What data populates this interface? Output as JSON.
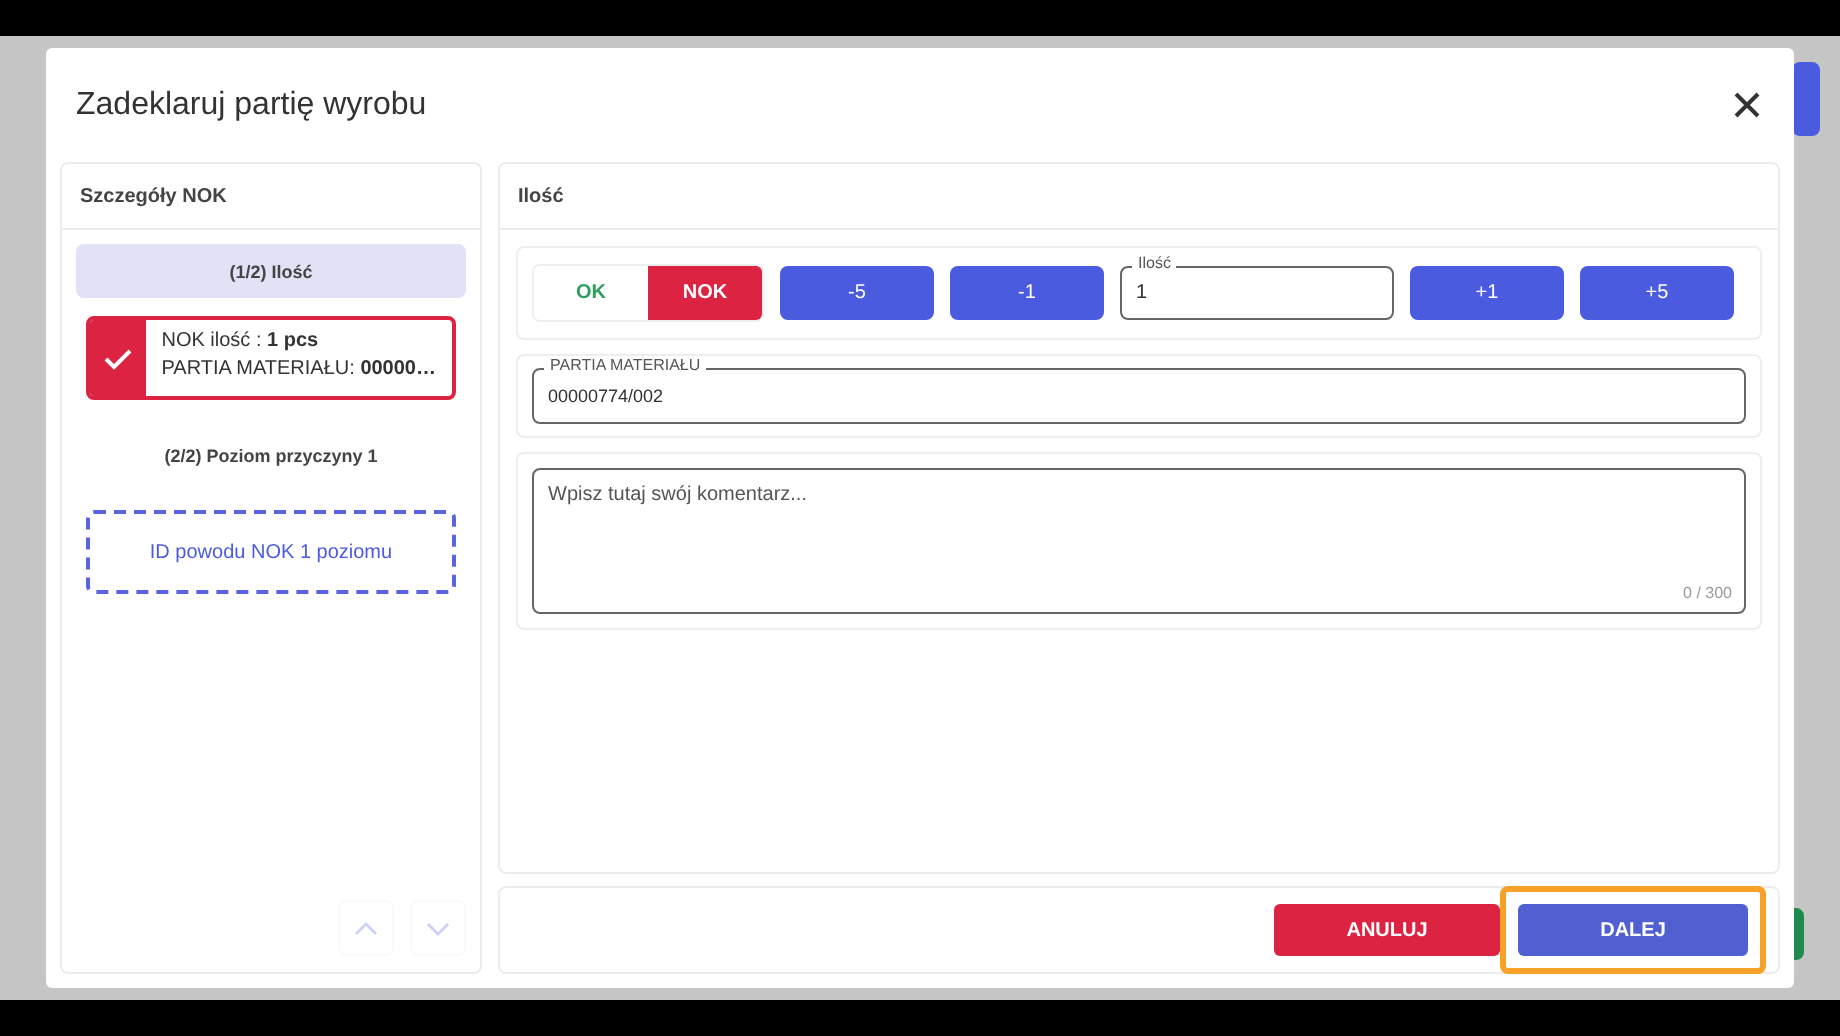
{
  "dialog": {
    "title": "Zadeklaruj partię wyrobu"
  },
  "details_panel": {
    "title": "Szczegóły NOK",
    "steps": [
      {
        "label": "(1/2) Ilość",
        "selected": true,
        "card": {
          "kind": "done",
          "line_1": "NOK ilość : **1 pcs**",
          "line_2": "PARTIA MATERIAŁU: **00000…**"
        }
      },
      {
        "label": "(2/2) Poziom przyczyny 1",
        "selected": false,
        "card": {
          "kind": "pending",
          "text": "ID powodu NOK 1 poziomu"
        }
      }
    ],
    "nav": {
      "up_disabled": true,
      "down_disabled": true
    }
  },
  "quantity_panel": {
    "title": "Ilość",
    "status_toggle": [
      {
        "label": "OK",
        "selected": false
      },
      {
        "label": "NOK",
        "selected": true
      }
    ],
    "decrement_buttons": [
      "-5",
      "-1"
    ],
    "quantity_field": {
      "label": "Ilość",
      "value": "1"
    },
    "increment_buttons": [
      "+1",
      "+5"
    ],
    "material_field": {
      "label": "PARTIA MATERIAŁU",
      "value": "00000774/002"
    },
    "comment": {
      "placeholder": "Wpisz tutaj swój komentarz...",
      "counter": "0 / 300"
    }
  },
  "footer_buttons": [
    {
      "label": "ANULUJ",
      "kind": "cancel",
      "highlighted": false
    },
    {
      "label": "DALEJ",
      "kind": "primary",
      "highlighted": true
    }
  ]
}
